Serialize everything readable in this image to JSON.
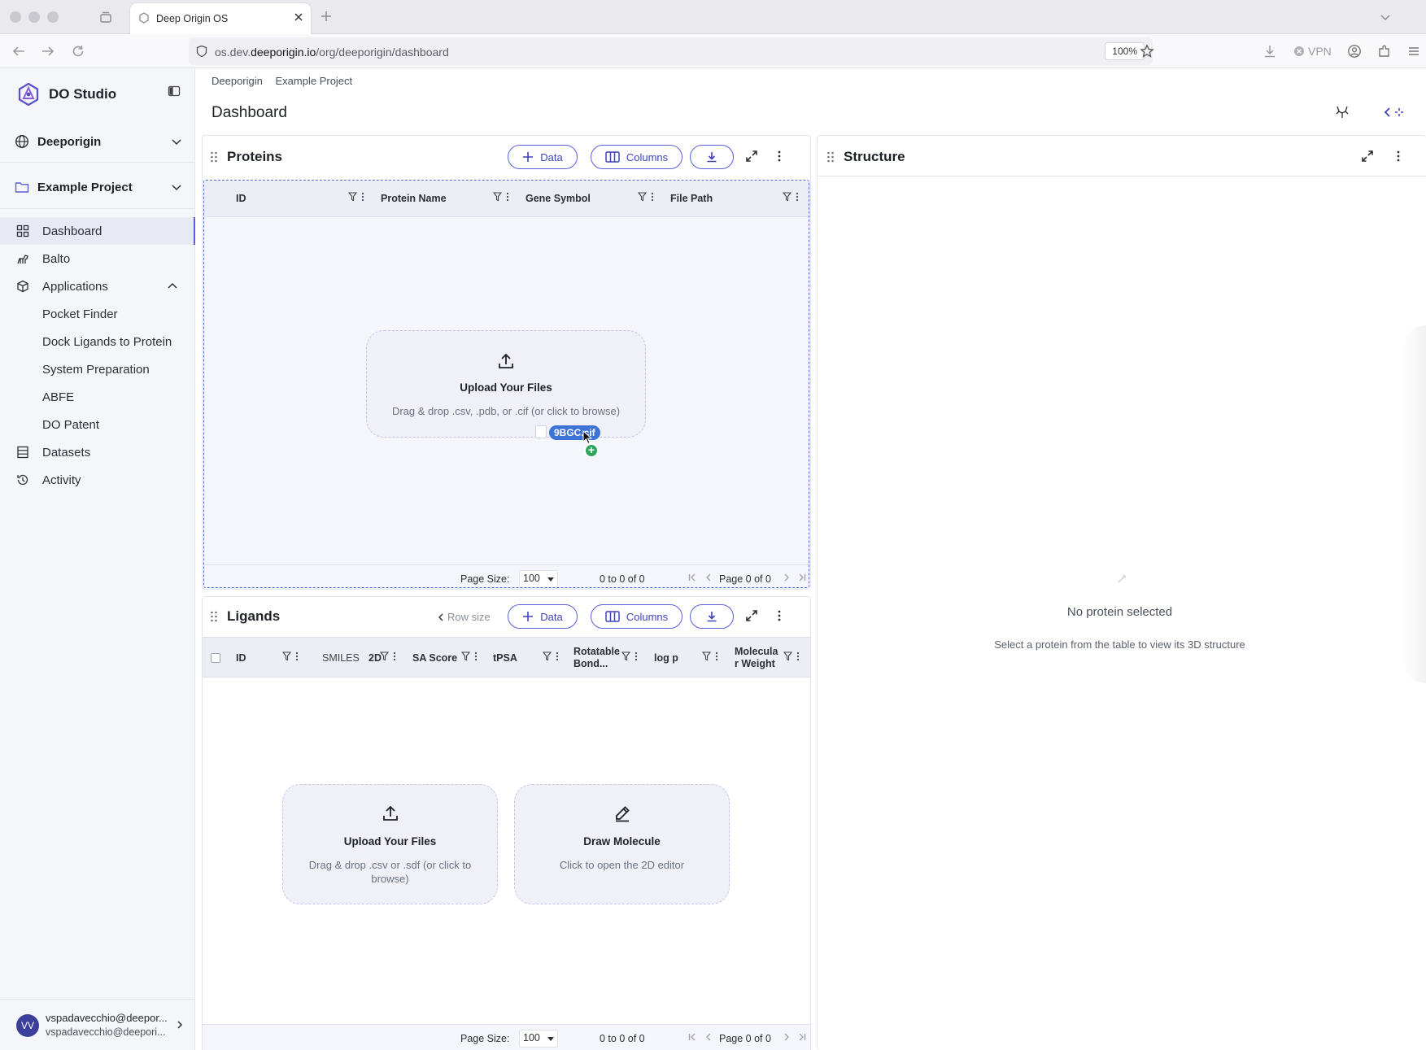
{
  "browser": {
    "tab_title": "Deep Origin OS",
    "url_prefix": "os.dev.",
    "url_domain": "deeporigin.io",
    "url_path": "/org/deeporigin/dashboard",
    "zoom": "100%",
    "vpn_label": "VPN"
  },
  "sidebar": {
    "app_name": "DO Studio",
    "org": "Deeporigin",
    "project": "Example Project",
    "nav": {
      "dashboard": "Dashboard",
      "balto": "Balto",
      "applications": "Applications",
      "pocket_finder": "Pocket Finder",
      "dock": "Dock Ligands to Protein",
      "system_prep": "System Preparation",
      "abfe": "ABFE",
      "patent": "DO Patent",
      "datasets": "Datasets",
      "activity": "Activity"
    },
    "user": {
      "initials": "VV",
      "line1": "vspadavecchio@deepor...",
      "line2": "vspadavecchio@deepori..."
    }
  },
  "breadcrumb": {
    "org": "Deeporigin",
    "project": "Example Project"
  },
  "page_title": "Dashboard",
  "proteins": {
    "title": "Proteins",
    "data_btn": "Data",
    "columns_btn": "Columns",
    "columns": [
      "ID",
      "Protein Name",
      "Gene Symbol",
      "File Path"
    ],
    "upload_title": "Upload Your Files",
    "upload_sub": "Drag & drop .csv, .pdb, or .cif (or click to browse)",
    "dragged_file": "9BGC.cif",
    "page_size_label": "Page Size:",
    "page_size": "100",
    "range": "0 to 0 of 0",
    "page": "Page 0 of 0"
  },
  "ligands": {
    "title": "Ligands",
    "row_size": "Row size",
    "data_btn": "Data",
    "columns_btn": "Columns",
    "columns": {
      "id": "ID",
      "smiles": "SMILES",
      "smiles_2d": "2D",
      "sa": "SA Score",
      "tpsa": "tPSA",
      "rot1": "Rotatable",
      "rot2": "Bond...",
      "logp": "log p",
      "mw1": "Molecula",
      "mw2": "r Weight"
    },
    "upload_title": "Upload Your Files",
    "upload_sub1": "Drag & drop .csv or .sdf (or click to",
    "upload_sub2": "browse)",
    "draw_title": "Draw Molecule",
    "draw_sub": "Click to open the 2D editor",
    "page_size_label": "Page Size:",
    "page_size": "100",
    "range": "0 to 0 of 0",
    "page": "Page 0 of 0"
  },
  "structure": {
    "title": "Structure",
    "empty_title": "No protein selected",
    "empty_sub": "Select a protein from the table to view its 3D structure"
  },
  "colors": {
    "accent": "#5b5fd6",
    "drag_chip": "#3d72d8",
    "plus_badge": "#2fa55a"
  }
}
